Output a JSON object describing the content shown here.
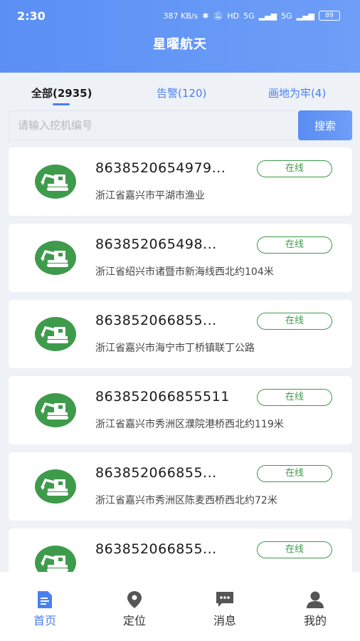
{
  "status_bar": {
    "time": "2:30",
    "network_speed": "387 KB/s",
    "signal_1": "5G",
    "signal_2": "5G",
    "hd": "HD",
    "battery": "89"
  },
  "header": {
    "title": "星曜航天"
  },
  "tabs": [
    {
      "label": "全部(2935)",
      "active": true
    },
    {
      "label": "告警(120)",
      "active": false
    },
    {
      "label": "画地为牢(4)",
      "active": false
    }
  ],
  "search": {
    "placeholder": "请输入挖机编号",
    "value": "",
    "button_label": "搜索"
  },
  "devices": [
    {
      "id": "8638520654979...",
      "status": "在线",
      "address": "浙江省嘉兴市平湖市渔业"
    },
    {
      "id": "863852065498...",
      "status": "在线",
      "address": "浙江省绍兴市诸暨市新海线西北约104米"
    },
    {
      "id": "863852066855...",
      "status": "在线",
      "address": "浙江省嘉兴市海宁市丁桥镇联丁公路"
    },
    {
      "id": "863852066855511",
      "status": "在线",
      "address": "浙江省嘉兴市秀洲区濮院港桥西北约119米"
    },
    {
      "id": "863852066855...",
      "status": "在线",
      "address": "浙江省嘉兴市秀洲区陈麦西桥西北约72米"
    },
    {
      "id": "863852066855...",
      "status": "在线",
      "address": ""
    }
  ],
  "tabbar": [
    {
      "label": "首页",
      "icon": "document-icon",
      "active": true
    },
    {
      "label": "定位",
      "icon": "location-pin-icon",
      "active": false
    },
    {
      "label": "消息",
      "icon": "chat-bubble-icon",
      "active": false
    },
    {
      "label": "我的",
      "icon": "user-icon",
      "active": false
    }
  ],
  "colors": {
    "primary": "#4a7ff0",
    "online": "#3c9a4a",
    "avatar_bg": "#3e9b4b",
    "background": "#eef1f6"
  }
}
